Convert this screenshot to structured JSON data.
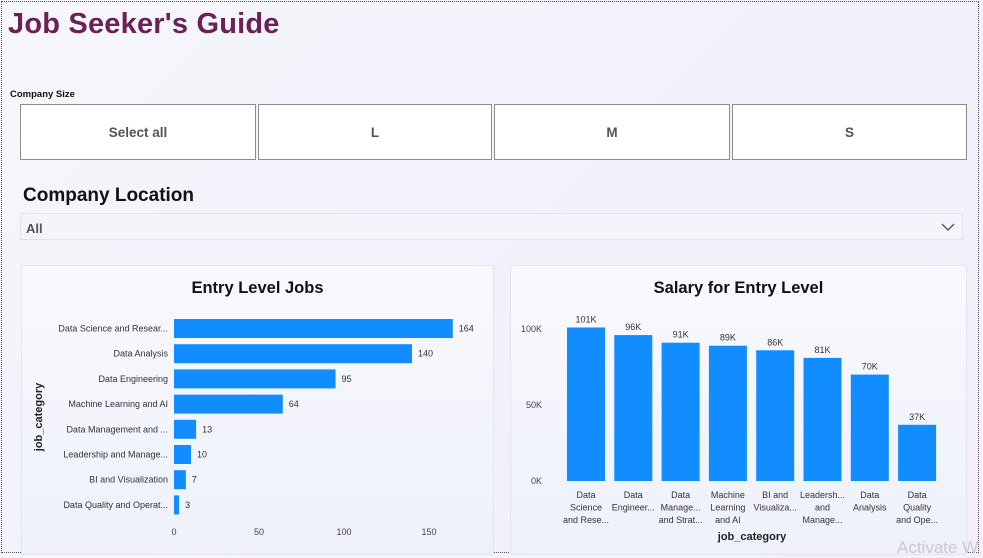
{
  "title": "Job Seeker's Guide",
  "company_size": {
    "label": "Company Size",
    "options": [
      "Select all",
      "L",
      "M",
      "S"
    ]
  },
  "company_location": {
    "label": "Company Location",
    "value": "All"
  },
  "colors": {
    "bar": "#118dff",
    "title": "#6b2057"
  },
  "watermark": "Activate W",
  "chart_data": [
    {
      "type": "bar",
      "orientation": "horizontal",
      "title": "Entry Level Jobs",
      "ylabel": "job_category",
      "xlabel": "",
      "categories": [
        "Data Science and Resear...",
        "Data Analysis",
        "Data Engineering",
        "Machine Learning and AI",
        "Data Management and ...",
        "Leadership and Manage...",
        "BI and Visualization",
        "Data Quality and Operat..."
      ],
      "values": [
        164,
        140,
        95,
        64,
        13,
        10,
        7,
        3
      ],
      "data_labels": [
        "164",
        "140",
        "95",
        "64",
        "13",
        "10",
        "7",
        "3"
      ],
      "x_ticks": [
        "0",
        "50",
        "100",
        "150"
      ],
      "xlim": [
        0,
        170
      ],
      "grid": false
    },
    {
      "type": "bar",
      "orientation": "vertical",
      "title": "Salary for Entry Level",
      "xlabel": "job_category",
      "ylabel": "",
      "categories": [
        [
          "Data",
          "Science",
          "and Rese..."
        ],
        [
          "Data",
          "Engineer..."
        ],
        [
          "Data",
          "Manage...",
          "and Strat..."
        ],
        [
          "Machine",
          "Learning",
          "and AI"
        ],
        [
          "BI and",
          "Visualiza..."
        ],
        [
          "Leadersh...",
          "and",
          "Manage..."
        ],
        [
          "Data",
          "Analysis"
        ],
        [
          "Data",
          "Quality",
          "and Ope..."
        ]
      ],
      "values": [
        101000,
        96000,
        91000,
        89000,
        86000,
        81000,
        70000,
        37000
      ],
      "data_labels": [
        "101K",
        "96K",
        "91K",
        "89K",
        "86K",
        "81K",
        "70K",
        "37K"
      ],
      "y_ticks": [
        "0K",
        "50K",
        "100K"
      ],
      "ylim": [
        0,
        100000
      ],
      "grid": false
    }
  ]
}
